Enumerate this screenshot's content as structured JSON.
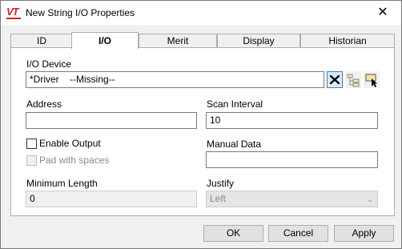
{
  "window": {
    "app_icon_text": "VT",
    "title": "New String I/O Properties",
    "close_glyph": "✕"
  },
  "tabs": [
    {
      "label": "ID",
      "active": false
    },
    {
      "label": "I/O",
      "active": true
    },
    {
      "label": "Merit",
      "active": false
    },
    {
      "label": "Display",
      "active": false
    },
    {
      "label": "Historian",
      "active": false
    }
  ],
  "io_device": {
    "label": "I/O Device",
    "value": "*Driver    --Missing--",
    "buttons": [
      {
        "icon": "clear-icon"
      },
      {
        "icon": "tree-browse-icon"
      },
      {
        "icon": "select-device-icon"
      }
    ]
  },
  "address": {
    "label": "Address",
    "value": ""
  },
  "scan_interval": {
    "label": "Scan Interval",
    "value": "10"
  },
  "enable_output": {
    "label": "Enable Output",
    "checked": false
  },
  "pad_with_spaces": {
    "label": "Pad with spaces",
    "checked": false,
    "disabled": true
  },
  "manual_data": {
    "label": "Manual Data",
    "value": ""
  },
  "minimum_length": {
    "label": "Minimum Length",
    "value": "0"
  },
  "justify": {
    "label": "Justify",
    "value": "Left"
  },
  "buttons": {
    "ok": "OK",
    "cancel": "Cancel",
    "apply": "Apply"
  },
  "colors": {
    "accent": "#d42020",
    "selection_border": "#3c7fb1"
  }
}
